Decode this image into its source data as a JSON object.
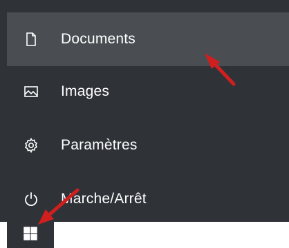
{
  "start_menu": {
    "items": [
      {
        "label": "Documents",
        "icon": "document-icon"
      },
      {
        "label": "Images",
        "icon": "image-icon"
      },
      {
        "label": "Paramètres",
        "icon": "gear-icon"
      },
      {
        "label": "Marche/Arrêt",
        "icon": "power-icon"
      }
    ],
    "hovered_item": "Documents"
  },
  "taskbar": {
    "start_button_icon": "windows-logo-icon"
  },
  "annotations": {
    "arrow_color": "#d11f1f"
  },
  "colors": {
    "menu_background": "#2f3338",
    "hover_background": "#4a4e53",
    "text": "#ffffff"
  }
}
